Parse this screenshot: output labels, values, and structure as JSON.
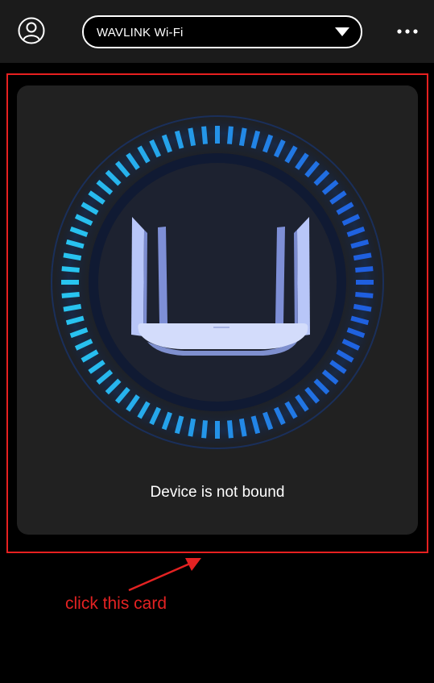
{
  "header": {
    "network_name": "WAVLINK Wi-Fi",
    "avatar_icon": "user-avatar-icon",
    "dropdown_icon": "caret-down-icon",
    "menu_icon": "more-dots-icon"
  },
  "device_card": {
    "status_text": "Device is not bound",
    "image": "router-icon",
    "ring_colors": {
      "start": "#28c4f0",
      "end": "#1f5fe0"
    }
  },
  "annotation": {
    "text": "click this card",
    "color": "#e32222"
  }
}
